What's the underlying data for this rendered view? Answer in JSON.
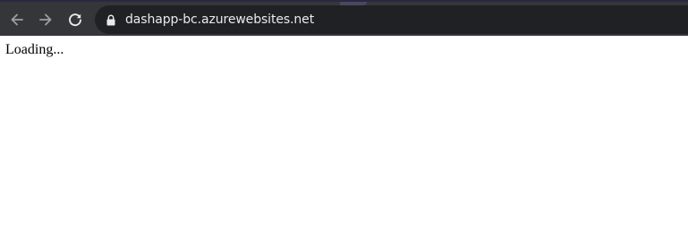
{
  "browser": {
    "url": "dashapp-bc.azurewebsites.net",
    "icons": {
      "back": "arrow-left-icon",
      "forward": "arrow-right-icon",
      "reload": "reload-icon",
      "lock": "lock-icon"
    },
    "colors": {
      "toolbar": "#35363a",
      "omnibox": "#202124",
      "icon": "#9aa0a6",
      "url_text": "#e8eaed"
    }
  },
  "page": {
    "status_text": "Loading..."
  }
}
